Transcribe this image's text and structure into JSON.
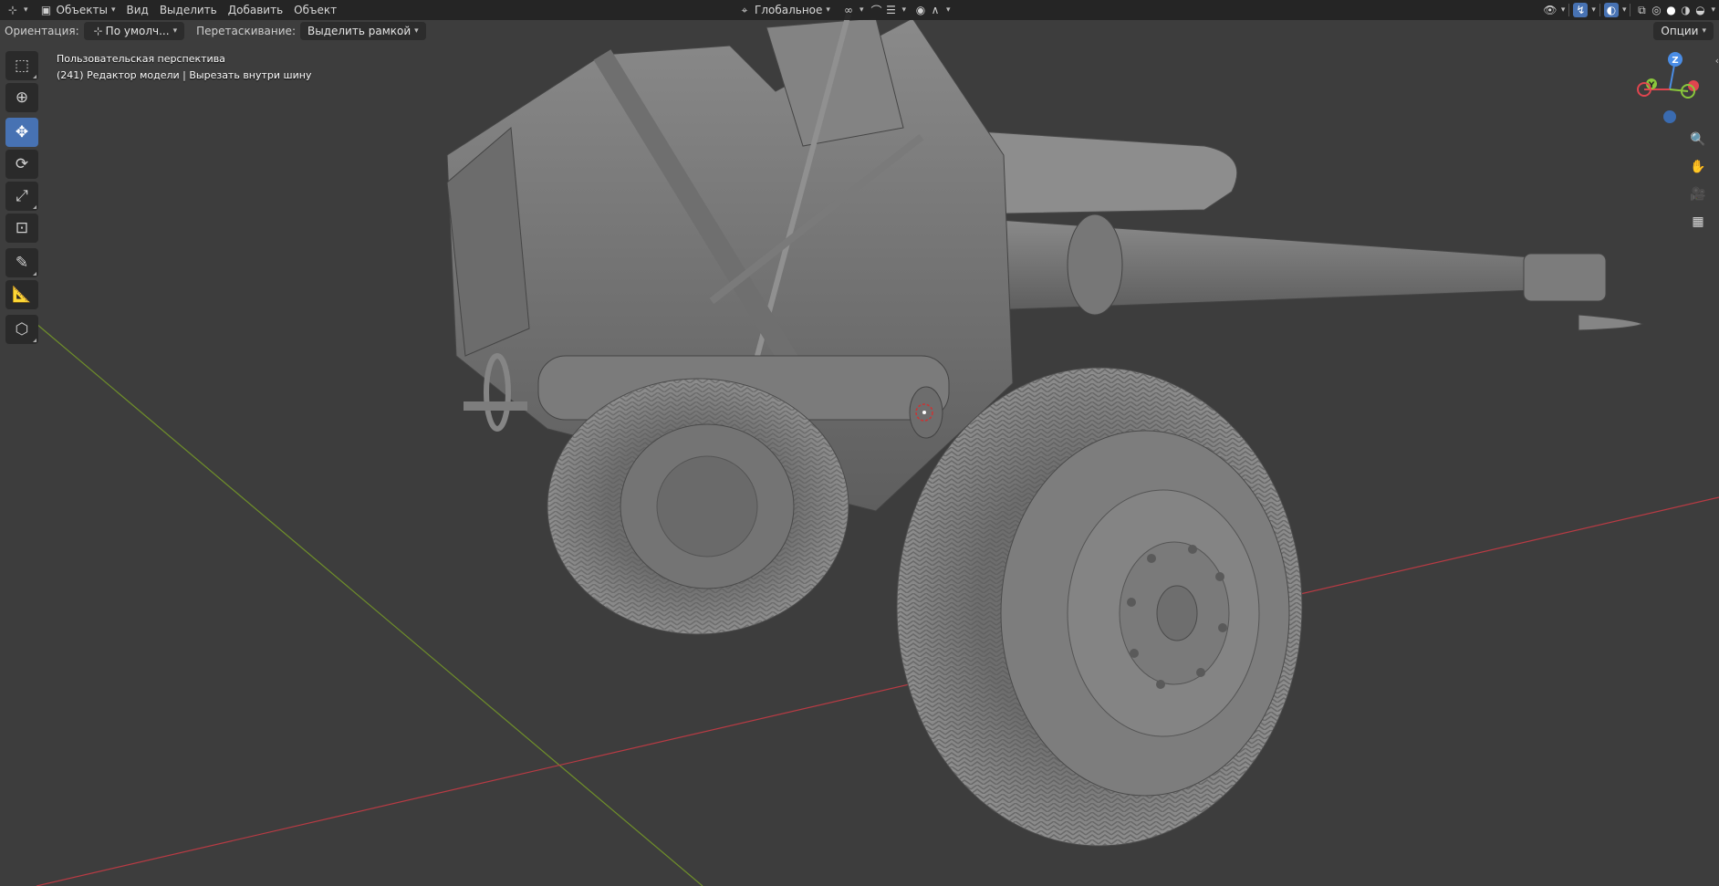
{
  "header": {
    "mode_icon": "mesh-mode-icon",
    "mode_label": "Объекты",
    "menu": [
      "Вид",
      "Выделить",
      "Добавить",
      "Объект"
    ],
    "transform_orientation": "Глобальное",
    "icons": [
      "snap-link-icon",
      "snap-icon",
      "snap-increment-icon",
      "proportional-edit-icon",
      "falloff-icon",
      "visibility-icon",
      "gizmo-icon",
      "overlay-icon",
      "xray-icon",
      "wireframe-shading-icon",
      "solid-shading-icon",
      "material-shading-icon",
      "render-shading-icon"
    ]
  },
  "tool_settings": {
    "orientation_label": "Ориентация:",
    "orientation_value": "По умолч...",
    "drag_label": "Перетаскивание:",
    "drag_value": "Выделить рамкой",
    "options_label": "Опции"
  },
  "left_toolbar": [
    {
      "name": "select-box-tool",
      "icon": "select-box-icon",
      "active": false
    },
    {
      "name": "cursor-tool",
      "icon": "cursor-icon",
      "active": false
    },
    {
      "name": "move-tool",
      "icon": "move-icon",
      "active": true
    },
    {
      "name": "rotate-tool",
      "icon": "rotate-icon",
      "active": false
    },
    {
      "name": "scale-tool",
      "icon": "scale-icon",
      "active": false
    },
    {
      "name": "transform-tool",
      "icon": "transform-icon",
      "active": false
    },
    {
      "name": "annotate-tool",
      "icon": "annotate-icon",
      "active": false
    },
    {
      "name": "measure-tool",
      "icon": "measure-icon",
      "active": false
    },
    {
      "name": "add-cube-tool",
      "icon": "add-cube-icon",
      "active": false
    }
  ],
  "viewport": {
    "view_name": "Пользовательская перспектива",
    "object_info": "(241) Редактор модели | Вырезать внутри шину"
  },
  "gizmo": {
    "z_label": "Z",
    "y_label": "Y",
    "x_color": "#e0454f",
    "y_color": "#8ac73c",
    "z_color": "#4a8de6"
  },
  "colors": {
    "x_axis": "#b83b44",
    "y_axis": "#6f8f2a",
    "accent": "#4772b3",
    "background": "#3d3d3d"
  }
}
